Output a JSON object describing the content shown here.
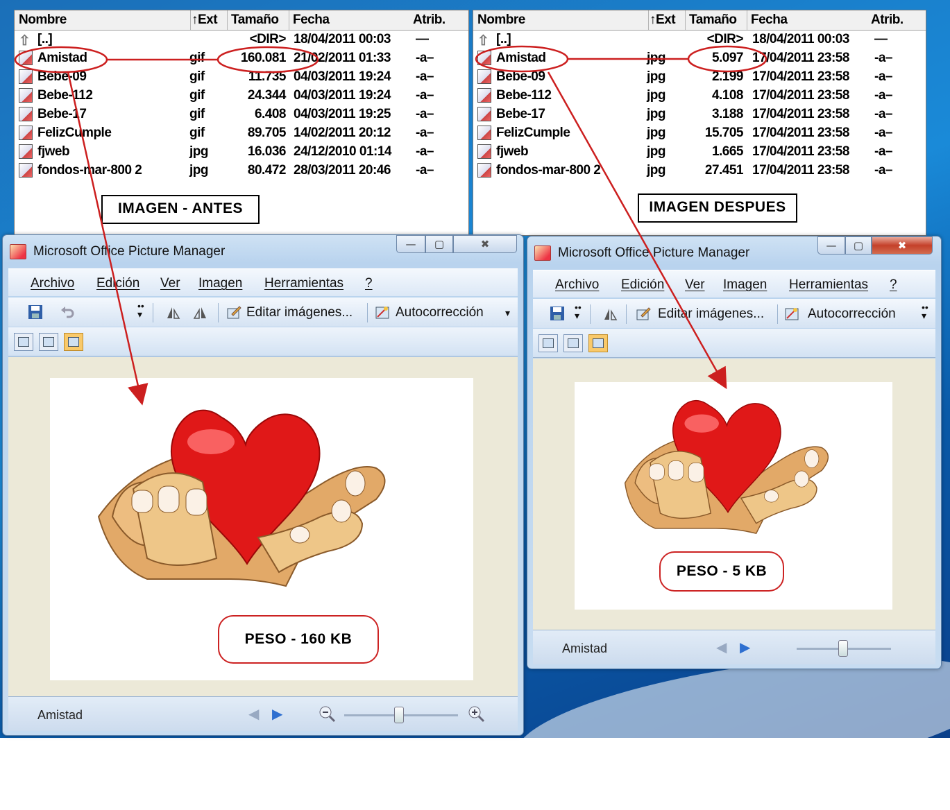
{
  "panels": {
    "headers": {
      "name": "Nombre",
      "ext": "↑Ext",
      "size": "Tamaño",
      "date": "Fecha",
      "attr": "Atrib."
    },
    "left": {
      "label": "IMAGEN - ANTES",
      "rows": [
        {
          "name": "[..]",
          "ext": "",
          "size": "<DIR>",
          "date": "18/04/2011 00:03",
          "attr": "—",
          "icon": "up-folder-icon"
        },
        {
          "name": "Amistad",
          "ext": "gif",
          "size": "160.081",
          "date": "21/02/2011 01:33",
          "attr": "-a–",
          "icon": "image-file-icon"
        },
        {
          "name": "Bebe-09",
          "ext": "gif",
          "size": "11.735",
          "date": "04/03/2011 19:24",
          "attr": "-a–",
          "icon": "image-file-icon"
        },
        {
          "name": "Bebe-112",
          "ext": "gif",
          "size": "24.344",
          "date": "04/03/2011 19:24",
          "attr": "-a–",
          "icon": "image-file-icon"
        },
        {
          "name": "Bebe-17",
          "ext": "gif",
          "size": "6.408",
          "date": "04/03/2011 19:25",
          "attr": "-a–",
          "icon": "image-file-icon"
        },
        {
          "name": "FelizCumple",
          "ext": "gif",
          "size": "89.705",
          "date": "14/02/2011 20:12",
          "attr": "-a–",
          "icon": "image-file-icon"
        },
        {
          "name": "fjweb",
          "ext": "jpg",
          "size": "16.036",
          "date": "24/12/2010 01:14",
          "attr": "-a–",
          "icon": "image-file-icon"
        },
        {
          "name": "fondos-mar-800 2",
          "ext": "jpg",
          "size": "80.472",
          "date": "28/03/2011 20:46",
          "attr": "-a–",
          "icon": "image-file-icon"
        }
      ]
    },
    "right": {
      "label": "IMAGEN DESPUES",
      "rows": [
        {
          "name": "[..]",
          "ext": "",
          "size": "<DIR>",
          "date": "18/04/2011 00:03",
          "attr": "—",
          "icon": "up-folder-icon"
        },
        {
          "name": "Amistad",
          "ext": "jpg",
          "size": "5.097",
          "date": "17/04/2011 23:58",
          "attr": "-a–",
          "icon": "image-file-icon"
        },
        {
          "name": "Bebe-09",
          "ext": "jpg",
          "size": "2.199",
          "date": "17/04/2011 23:58",
          "attr": "-a–",
          "icon": "image-file-icon"
        },
        {
          "name": "Bebe-112",
          "ext": "jpg",
          "size": "4.108",
          "date": "17/04/2011 23:58",
          "attr": "-a–",
          "icon": "image-file-icon"
        },
        {
          "name": "Bebe-17",
          "ext": "jpg",
          "size": "3.188",
          "date": "17/04/2011 23:58",
          "attr": "-a–",
          "icon": "image-file-icon"
        },
        {
          "name": "FelizCumple",
          "ext": "jpg",
          "size": "15.705",
          "date": "17/04/2011 23:58",
          "attr": "-a–",
          "icon": "image-file-icon"
        },
        {
          "name": "fjweb",
          "ext": "jpg",
          "size": "1.665",
          "date": "17/04/2011 23:58",
          "attr": "-a–",
          "icon": "image-file-icon"
        },
        {
          "name": "fondos-mar-800 2",
          "ext": "jpg",
          "size": "27.451",
          "date": "17/04/2011 23:58",
          "attr": "-a–",
          "icon": "image-file-icon"
        }
      ]
    }
  },
  "app": {
    "title": "Microsoft Office Picture Manager",
    "menu": [
      "Archivo",
      "Edición",
      "Ver",
      "Imagen",
      "Herramientas",
      "?"
    ],
    "toolbar": {
      "edit_label": "Editar imágenes...",
      "autocorrect_label": "Autocorrección"
    },
    "status_name": "Amistad"
  },
  "left_window": {
    "peso": "PESO - 160 KB",
    "zoom_level": 0.5
  },
  "right_window": {
    "peso": "PESO - 5 KB",
    "zoom_level": 0.5
  },
  "colors": {
    "annotation": "#cc1f1f",
    "heart": "#e01818",
    "hand": "#f0c47e"
  }
}
